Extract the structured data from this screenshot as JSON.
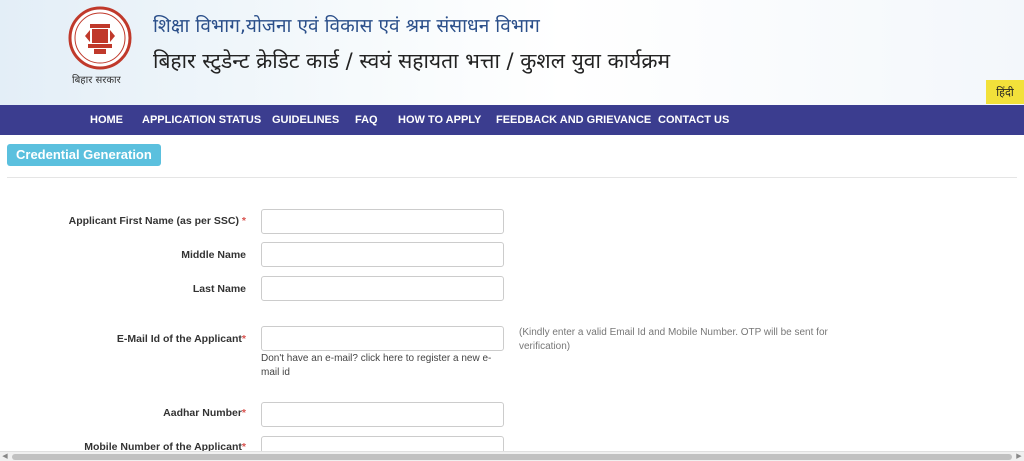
{
  "header": {
    "logo_icon": "bihar-emblem-icon",
    "logo_caption": "बिहार सरकार",
    "title_line1": "शिक्षा विभाग,योजना एवं विकास एवं श्रम संसाधन विभाग",
    "title_line2": "बिहार स्टुडेन्ट क्रेडिट कार्ड / स्वयं सहायता भत्ता / कुशल युवा कार्यक्रम",
    "language_button": "हिंदी"
  },
  "nav": {
    "items": [
      {
        "label": "HOME"
      },
      {
        "label": "APPLICATION STATUS"
      },
      {
        "label": "GUIDELINES"
      },
      {
        "label": "FAQ"
      },
      {
        "label": "HOW TO APPLY"
      },
      {
        "label": "FEEDBACK AND GRIEVANCE"
      },
      {
        "label": "CONTACT US"
      }
    ]
  },
  "section": {
    "title": "Credential Generation"
  },
  "form": {
    "first_name_label": "Applicant First Name (as per SSC)",
    "middle_name_label": "Middle Name",
    "last_name_label": "Last Name",
    "email_label": "E-Mail Id of the Applicant",
    "email_register_link": "Don't have an e-mail? click here to register a new e-mail id",
    "email_otp_note": "(Kindly enter a valid Email Id and Mobile Number. OTP will be sent for verification)",
    "aadhar_label": "Aadhar Number",
    "mobile_label": "Mobile Number of the Applicant",
    "required_mark": "*"
  },
  "colors": {
    "nav_background": "#3b3d8f",
    "section_badge": "#5bc0de",
    "language_button": "#f2e13a",
    "required": "#d9534f"
  }
}
